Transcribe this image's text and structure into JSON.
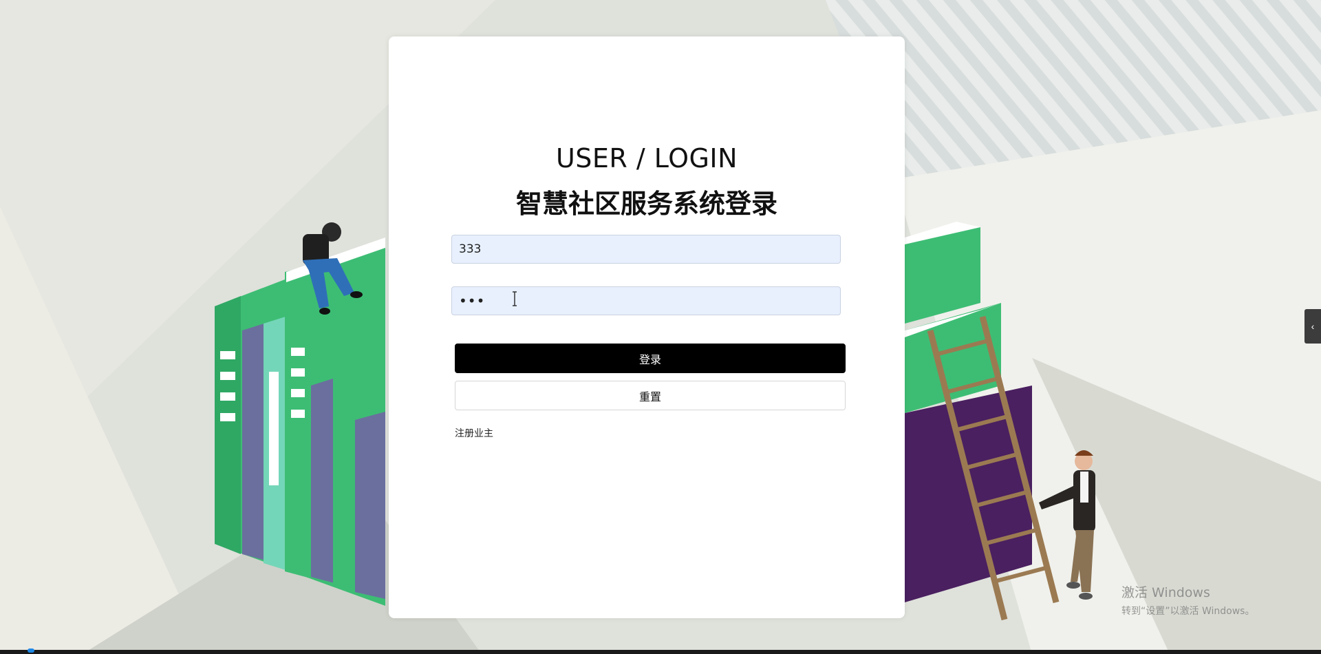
{
  "login": {
    "title_en": "USER / LOGIN",
    "title_cn": "智慧社区服务系统登录",
    "username_value": "333",
    "password_value": "333",
    "login_button": "登录",
    "reset_button": "重置",
    "register_link": "注册业主"
  },
  "side_tab": {
    "icon": "chevron-left-icon",
    "glyph": "‹"
  },
  "watermark": {
    "title": "激活 Windows",
    "subtitle": "转到“设置”以激活 Windows。"
  },
  "colors": {
    "book_green": "#3dbd74",
    "book_purple": "#6b6f9e",
    "book_dark_purple": "#4a2060",
    "login_button_bg": "#000000",
    "input_bg": "#e8f0fe"
  }
}
